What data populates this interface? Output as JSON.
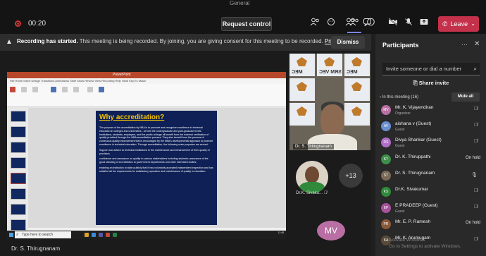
{
  "window": {
    "title_ghost": "General"
  },
  "topbar": {
    "timer": "00:20",
    "request_control_label": "Request control",
    "leave_label": "Leave",
    "icons": [
      "people-icon",
      "chat-icon",
      "reactions-icon",
      "rooms-icon",
      "more-icon",
      "camera-off-icon",
      "mic-off-icon",
      "share-tray-icon",
      "phone-icon"
    ]
  },
  "banner": {
    "lead": "Recording has started.",
    "text": "This meeting is being recorded. By joining, you are giving consent for this meeting to be recorded.",
    "link": "Privacy policy",
    "dismiss_label": "Dismiss"
  },
  "share": {
    "ppt_title": "PowerPoint",
    "menu": "File   Home   Insert   Design   Transitions   Animations   Slide Show   Review   View   Recording   Help   Hindi Key   Ex   Malar",
    "slide_title": "Why accreditation?",
    "slide_paragraphs": [
      "The purpose of the accreditation by NBA is to promote and recognize excellence in technical education in colleges and universities - at both the undergraduate and post-graduate levels. Institutions, students, employers, and the public at large all benefit from the external verification of quality provided through the NBA accreditation process. They also benefit from the process of continuous quality improvement that is encouraged by the NBA's developmental approach to promote excellence in technical education. Through accreditation, the following main purposes are served:",
      "Support and advice to technical institutions in the maintenance and enhancement of their quality of provision;",
      "confidence and assurance on quality to various stakeholders including students; assurance of the good standing of an institution to government departments and other interested bodies;",
      "enabling an institution to state publicly that it has voluntarily accepted independent inspection and has satisfied all the requirements for satisfactory operation and maintenance of quality in education."
    ],
    "taskbar_search": "Type here to search",
    "taskbar_clock": "11:48"
  },
  "presenter_name": "Dr. S. Thirugnanam",
  "gallery": {
    "main_video_name": "Dr. S. Thirugnanam",
    "bg_labels": [
      "MEC",
      "SRM VEC",
      "MEC"
    ],
    "tile_name": "Dr.K. Sivaku...",
    "overflow_count": "+13",
    "avatar_initials": "MV"
  },
  "participants": {
    "title": "Participants",
    "invite_placeholder": "Invite someone or dial a number",
    "share_invite_label": "Share invite",
    "in_meeting_label": "In this meeting (16)",
    "mute_all_label": "Mute all",
    "people": [
      {
        "initials": "MV",
        "name": "Mr. K. Vijayendiran",
        "role": "Organizer",
        "status": "",
        "color": "#b96fa3"
      },
      {
        "initials": "AV",
        "name": "aishana v (Guest)",
        "role": "Guest",
        "status": "",
        "color": "#6b8fd1"
      },
      {
        "initials": "DS",
        "name": "Divya Shankar (Guest)",
        "role": "Guest",
        "status": "",
        "color": "#b06ec6"
      },
      {
        "initials": "KT",
        "name": "Dr. K. Thiruppathi",
        "role": "",
        "status": "On hold",
        "color": "#3d8f4a"
      },
      {
        "initials": "ST",
        "name": "Dr. S. Thirugnanam",
        "role": "",
        "status": "",
        "color": "#7a6a55"
      },
      {
        "initials": "KS",
        "name": "Dr.K. Sivakumar",
        "role": "",
        "status": "",
        "color": "#2f8a3b"
      },
      {
        "initials": "EP",
        "name": "E PRADEEP (Guest)",
        "role": "Guest",
        "status": "",
        "color": "#a7529a"
      },
      {
        "initials": "PR",
        "name": "Mr. E. P. Ramesh",
        "role": "",
        "status": "On hold",
        "color": "#8a5a3a"
      },
      {
        "initials": "KA",
        "name": "Mr. K. Arumugam",
        "role": "",
        "status": "",
        "color": "#5a4a3a"
      }
    ]
  },
  "watermark": {
    "line1": "Activate Windows",
    "line2": "Go to Settings to activate Windows."
  },
  "colors": {
    "accent": "#7b83eb",
    "leave": "#c4314b",
    "slide_bg": "#0e2056",
    "slide_title": "#f5c400"
  }
}
